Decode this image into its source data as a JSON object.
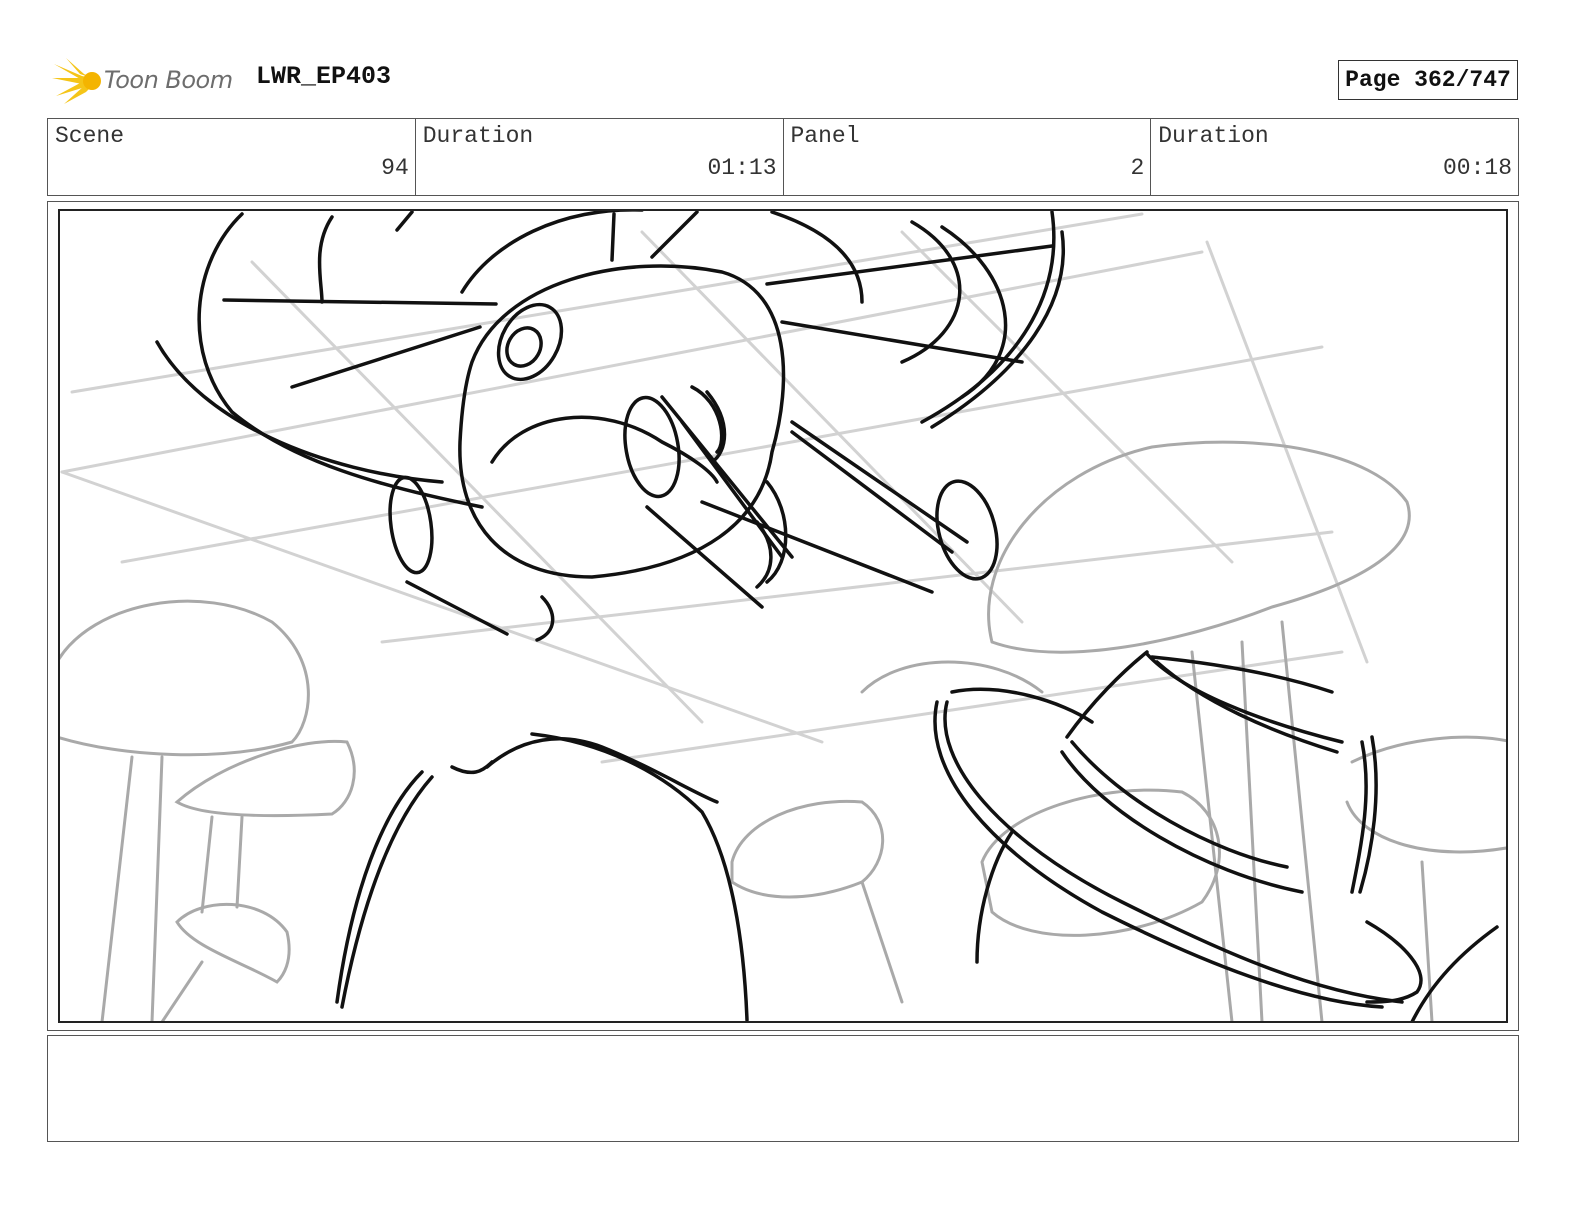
{
  "header": {
    "logo_text": "Toon Boom",
    "project": "LWR_EP403",
    "page": "Page 362/747"
  },
  "info": {
    "scene_label": "Scene",
    "scene_value": "94",
    "scene_duration_label": "Duration",
    "scene_duration_value": "01:13",
    "panel_label": "Panel",
    "panel_value": "2",
    "panel_duration_label": "Duration",
    "panel_duration_value": "00:18"
  },
  "notes": {
    "text": ""
  },
  "colors": {
    "logo_star": "#f5c518",
    "sketch_dark": "#111111",
    "sketch_light": "#b8b8b8"
  }
}
